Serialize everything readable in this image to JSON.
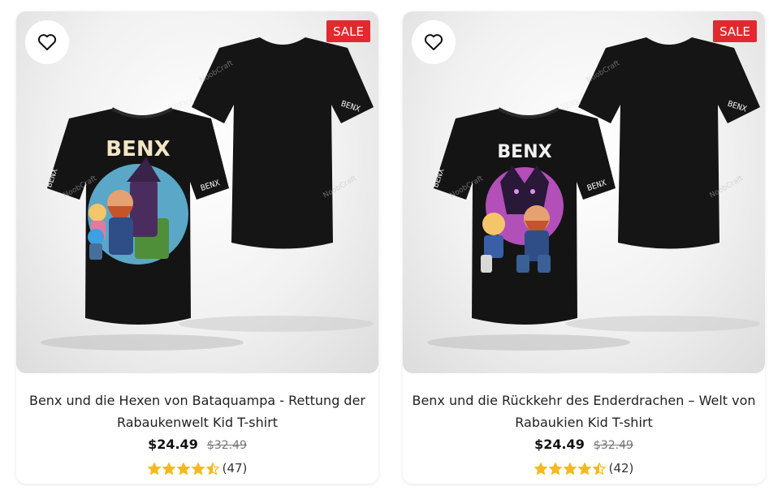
{
  "products": [
    {
      "badge": "SALE",
      "shirt_print_text": "BENX",
      "sleeve_text": "BENX",
      "watermark": "NoobCraft",
      "title": "Benx und die Hexen von Bataquampa - Rettung der Rabaukenwelt Kid T-shirt",
      "price": "$24.49",
      "old_price": "$32.49",
      "rating": 4.5,
      "review_count": "(47)",
      "print_circle_color": "#5aa7c7"
    },
    {
      "badge": "SALE",
      "shirt_print_text": "BENX",
      "sleeve_text": "BENX",
      "watermark": "NoobCraft",
      "title": "Benx und die Rückkehr des Enderdrachen – Welt von Rabaukien Kid T-shirt",
      "price": "$24.49",
      "old_price": "$32.49",
      "rating": 4.5,
      "review_count": "(42)",
      "print_circle_color": "#b24fb8"
    }
  ],
  "colors": {
    "sale_badge": "#e2292d",
    "star": "#f5b81f",
    "shirt": "#141414"
  },
  "icons": {
    "favorite": "heart-outline-icon",
    "rating": "star-icon"
  }
}
